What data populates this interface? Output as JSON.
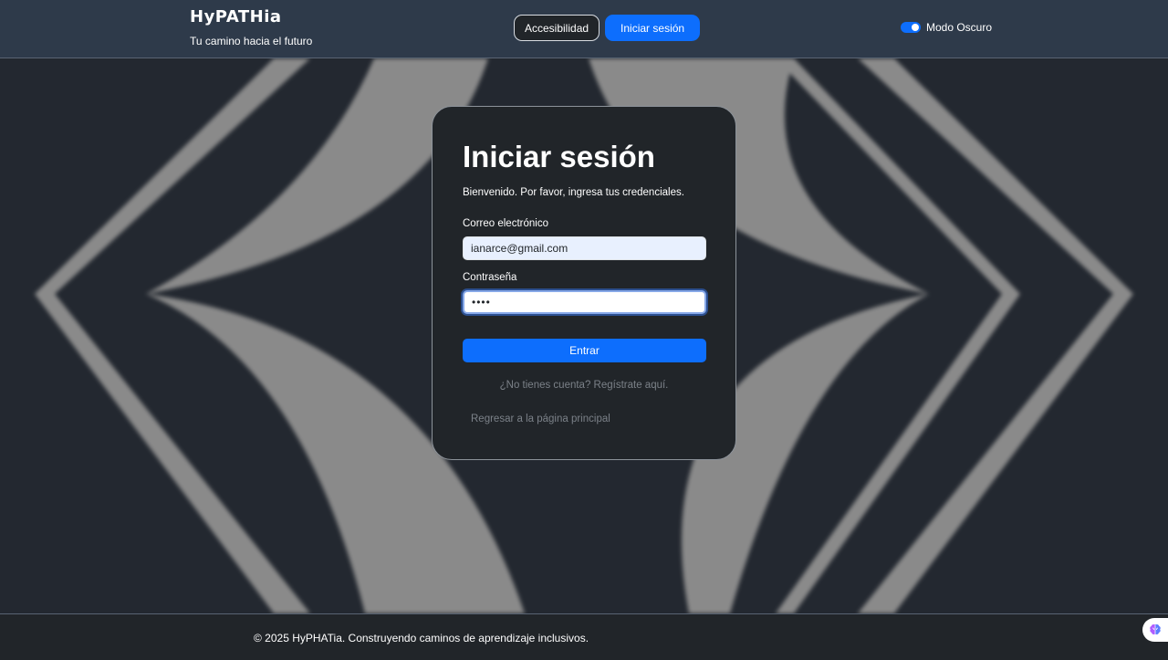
{
  "header": {
    "logo": "HyPATHia",
    "tagline": "Tu camino hacia el futuro",
    "accessibility_label": "Accesibilidad",
    "login_label": "Iniciar sesión",
    "dark_mode_label": "Modo Oscuro",
    "dark_mode_on": true
  },
  "login": {
    "title": "Iniciar sesión",
    "subtitle": "Bienvenido. Por favor, ingresa tus credenciales.",
    "email_label": "Correo electrónico",
    "email_value": "ianarce@gmail.com",
    "password_label": "Contraseña",
    "password_value": "••••",
    "submit_label": "Entrar",
    "register_link": "¿No tienes cuenta? Regístrate aquí.",
    "back_link": "Regresar a la página principal"
  },
  "footer": {
    "text": "© 2025 HyPHATia. Construyendo caminos de aprendizaje inclusivos."
  },
  "icons": {
    "assist_widget": "brain-icon",
    "dark_mode": "toggle-switch-icon"
  },
  "colors": {
    "primary": "#0d6efd",
    "header_bg": "#2e3a4a",
    "page_bg": "#232830",
    "card_bg": "#212529",
    "pattern": "#8a8a8a"
  }
}
